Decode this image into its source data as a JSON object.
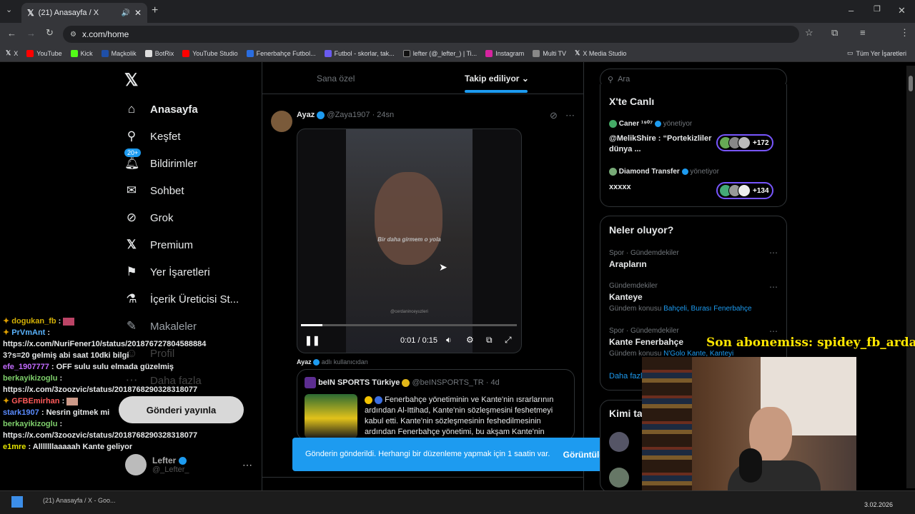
{
  "browser": {
    "tab_title": "(21) Anasayfa / X",
    "url": "x.com/home",
    "bookmarks": [
      "X",
      "YouTube",
      "Kick",
      "Maçkolik",
      "BotRix",
      "YouTube Studio",
      "Fenerbahçe Futbol...",
      "Futbol - skorlar, tak...",
      "lefter (@_lefter_) | Ti...",
      "Instagram",
      "Multi TV",
      "X Media Studio"
    ],
    "bookmarks_folder": "Tüm Yer İşaretleri"
  },
  "nav": {
    "items": [
      {
        "label": "Anasayfa",
        "icon": "home-icon"
      },
      {
        "label": "Keşfet",
        "icon": "search-icon"
      },
      {
        "label": "Bildirimler",
        "icon": "bell-icon"
      },
      {
        "label": "Sohbet",
        "icon": "mail-icon"
      },
      {
        "label": "Grok",
        "icon": "grok-icon"
      },
      {
        "label": "Premium",
        "icon": "x-icon"
      },
      {
        "label": "Yer İşaretleri",
        "icon": "bookmark-icon"
      },
      {
        "label": "İçerik Üreticisi St...",
        "icon": "flask-icon"
      },
      {
        "label": "Makaleler",
        "icon": "article-icon"
      },
      {
        "label": "Profil",
        "icon": "user-icon"
      },
      {
        "label": "Daha fazla",
        "icon": "more-icon"
      }
    ],
    "notif_badge": "20+",
    "post_button": "Gönderi yayınla",
    "user_name": "Lefter",
    "user_handle": "@_Lefter_"
  },
  "chat": [
    {
      "user": "dogukan_fb",
      "color": "#d4b106",
      "text": ""
    },
    {
      "user": "PrVmAnt",
      "color": "#5ab4ff",
      "text": ""
    },
    {
      "user": "",
      "color": "",
      "text": "https://x.com/NuriFener10/status/2018767278045888843?s=20 gelmiş abi saat 10dki bilgi"
    },
    {
      "user": "efe_1907777",
      "color": "#c36bff",
      "text": "OFF sulu sulu elmada güzelmiş"
    },
    {
      "user": "berkayikizoglu",
      "color": "#7fd06c",
      "text": ""
    },
    {
      "user": "",
      "color": "",
      "text": "https://x.com/3zoozvic/status/2018768290328318077"
    },
    {
      "user": "GFBEmirhan",
      "color": "#ff5a5a",
      "text": ""
    },
    {
      "user": "stark1907",
      "color": "#5a8bff",
      "text": "Nesrin gitmek mi"
    },
    {
      "user": "berkayikizoglu",
      "color": "#7fd06c",
      "text": ""
    },
    {
      "user": "",
      "color": "",
      "text": "https://x.com/3zoozvic/status/2018768290328318077"
    },
    {
      "user": "e1mre",
      "color": "#e6e600",
      "text": "Alllllllaaaaah Kante geliyor"
    }
  ],
  "feed": {
    "tabs": [
      "Sana özel",
      "Takip ediliyor"
    ],
    "active_tab": "Takip ediliyor",
    "post": {
      "author": "Ayaz",
      "handle": "@Zaya1907",
      "time": "24sn",
      "video_caption": "Bir daha girmem o yola",
      "video_watermark": "@cerdaninceyuzleri",
      "time_display": "0:01 / 0:15",
      "progress": 0.1
    },
    "quote_header_name": "Ayaz",
    "quote_header_text": "adlı kullanıcıdan",
    "quote": {
      "author": "beIN SPORTS Türkiye",
      "handle": "@beINSPORTS_TR",
      "time": "4d",
      "text": "Fenerbahçe yönetiminin ve Kante'nin ısrarlarının ardından Al-Ittihad, Kante'nin sözleşmesini feshetmeyi kabul etti. Kante'nin sözleşmesinin feshedilmesinin ardından Fenerbahçe yönetimi, bu akşam Kante'nin"
    },
    "toast": "Gönderin gönderildi. Herhangi bir düzenleme yapmak için 1 saatin var.",
    "toast_action": "Görüntüle"
  },
  "sidebar": {
    "search_placeholder": "Ara",
    "live_title": "X'te Canlı",
    "live": [
      {
        "host": "Caner ¹⁹⁰⁷",
        "role": "yönetiyor",
        "title": "@MelikShire : “Portekizliler dünya ...",
        "count": "+172"
      },
      {
        "host": "Diamond Transfer",
        "role": "yönetiyor",
        "title": "xxxxx",
        "count": "+134"
      }
    ],
    "trends_title": "Neler oluyor?",
    "trends": [
      {
        "cat": "Spor · Gündemdekiler",
        "name": "Arapların",
        "sub_label": "",
        "sub_links": ""
      },
      {
        "cat": "Gündemdekiler",
        "name": "Kanteye",
        "sub_label": "Gündem konusu",
        "sub_links": "Bahçeli, Burası Fenerbahçe"
      },
      {
        "cat": "Spor · Gündemdekiler",
        "name": "Kante Fenerbahçe",
        "sub_label": "Gündem konusu",
        "sub_links": "N'Golo Kante, Kanteyi"
      }
    ],
    "show_more": "Daha fazla",
    "who_title": "Kimi takip etmeli"
  },
  "overlay": {
    "subscriber": "Son abonemiss: spidey_fb_arda"
  },
  "taskbar": {
    "task": "(21) Anasayfa / X - Goo...",
    "date": "3.02.2026"
  }
}
